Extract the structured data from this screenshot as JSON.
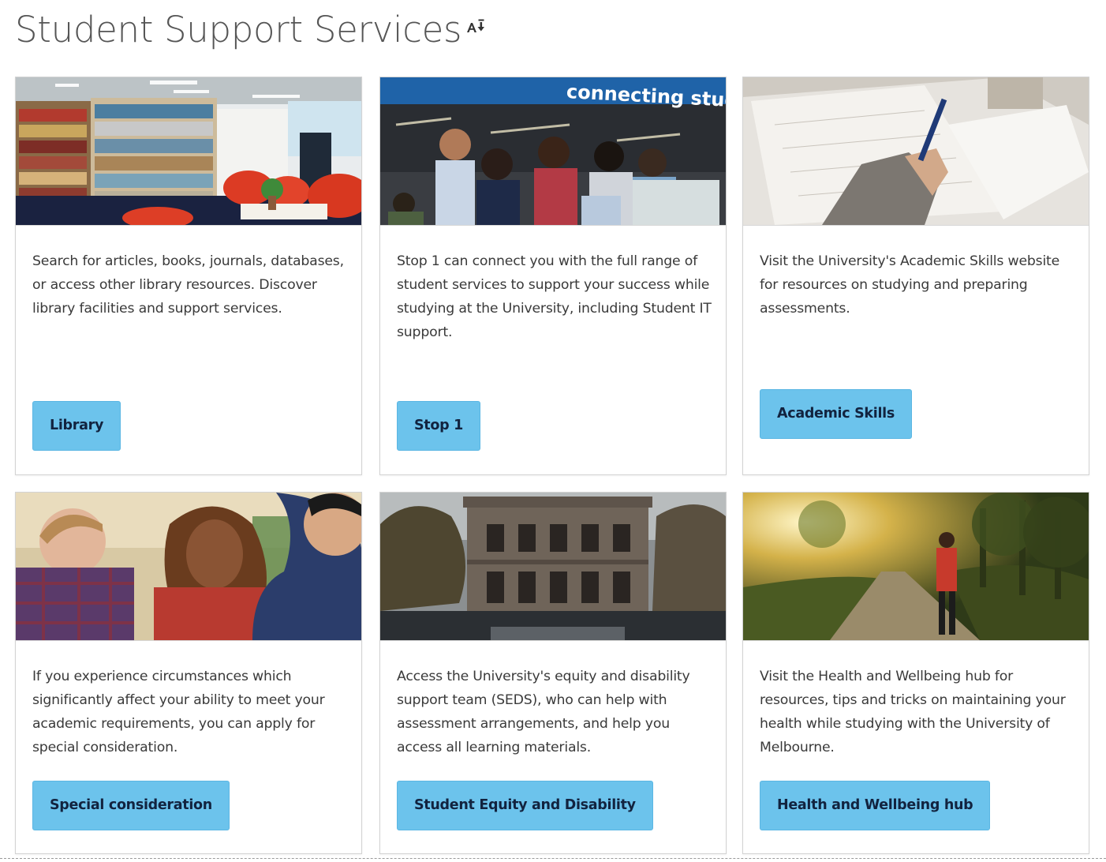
{
  "page": {
    "title": "Student Support Services"
  },
  "cards": [
    {
      "image_subject": "library-bookshelves-with-red-armchairs",
      "text": "Search for articles, books, journals, databases, or access other library resources. Discover library facilities and support services.",
      "button_label": "Library"
    },
    {
      "image_subject": "students-gathered-at-stop-1-help-desk",
      "image_text": "connecting student",
      "text": "Stop 1 can connect you with the full range of student services to support your success while studying at the University, including Student IT support.",
      "button_label": "Stop 1"
    },
    {
      "image_subject": "hand-writing-with-pen-on-paper",
      "text": "Visit the University's Academic Skills website for resources on studying and preparing assessments.",
      "button_label": "Academic Skills"
    },
    {
      "image_subject": "three-people-in-conversation",
      "text": "If you experience circumstances which significantly affect your ability to meet your academic requirements, you can apply for special consideration.",
      "button_label": "Special consideration"
    },
    {
      "image_subject": "historic-sandstone-university-building",
      "text": "Access the University's equity and disability support team (SEDS), who can help with assessment arrangements, and help you access all learning materials.",
      "button_label": "Student Equity and Disability"
    },
    {
      "image_subject": "person-stretching-on-sunlit-path",
      "text": "Visit the Health and Wellbeing hub for resources, tips and tricks on maintaining your health while studying with the University of Melbourne.",
      "button_label": "Health and Wellbeing hub"
    }
  ],
  "colors": {
    "button_bg": "#6cc3ec",
    "button_text": "#12233f",
    "title": "#555555",
    "body_text": "#3a3a3a",
    "card_border": "#d3d3d3"
  },
  "icons": {
    "title_adjacent": "accessibility-adjust-icon"
  }
}
